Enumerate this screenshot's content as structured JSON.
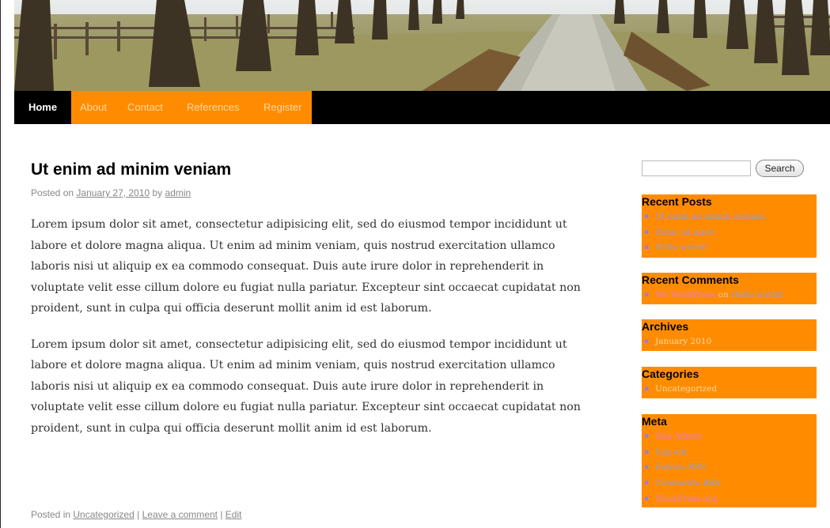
{
  "nav": {
    "items": [
      {
        "label": "Home"
      },
      {
        "label": "About"
      },
      {
        "label": "Contact"
      },
      {
        "label": "References"
      },
      {
        "label": "Register"
      }
    ]
  },
  "post": {
    "title": "Ut enim ad minim veniam",
    "posted_on_label": "Posted on",
    "date": "January 27, 2010",
    "by_label": "by",
    "author": "admin",
    "paragraphs": [
      "Lorem ipsum dolor sit amet, consectetur adipisicing elit, sed do eiusmod tempor incididunt ut labore et dolore magna aliqua. Ut enim ad minim veniam, quis nostrud exercitation ullamco laboris nisi ut aliquip ex ea commodo consequat. Duis aute irure dolor in reprehenderit in voluptate velit esse cillum dolore eu fugiat nulla pariatur. Excepteur sint occaecat cupidatat non proident, sunt in culpa qui officia deserunt mollit anim id est laborum.",
      "Lorem ipsum dolor sit amet, consectetur adipisicing elit, sed do eiusmod tempor incididunt ut labore et dolore magna aliqua. Ut enim ad minim veniam, quis nostrud exercitation ullamco laboris nisi ut aliquip ex ea commodo consequat. Duis aute irure dolor in reprehenderit in voluptate velit esse cillum dolore eu fugiat nulla pariatur. Excepteur sint occaecat cupidatat non proident, sunt in culpa qui officia deserunt mollit anim id est laborum."
    ],
    "footer": {
      "posted_in_label": "Posted in",
      "category": "Uncategorized",
      "separator": "|",
      "comment_link": "Leave a comment",
      "edit_link": "Edit"
    }
  },
  "sidebar": {
    "search": {
      "placeholder": "",
      "button_label": "Search"
    },
    "recent_posts": {
      "title": "Recent Posts",
      "items": [
        "Ut enim ad minim veniam",
        "Dolor sit amet",
        "Hello world!"
      ]
    },
    "recent_comments": {
      "title": "Recent Comments",
      "author": "Mr WordPress",
      "on_label": "on",
      "post": "Hello world!"
    },
    "archives": {
      "title": "Archives",
      "items": [
        "January 2010"
      ]
    },
    "categories": {
      "title": "Categories",
      "items": [
        "Uncategorized"
      ]
    },
    "meta": {
      "title": "Meta",
      "items": [
        "Site Admin",
        "Log out",
        "Entries RSS",
        "Comments RSS",
        "WordPress.org"
      ]
    }
  },
  "colors": {
    "accent": "#ff8c00",
    "nav_background": "#000000",
    "link_blue": "#8f9be8",
    "link_pink": "#e57adb"
  }
}
